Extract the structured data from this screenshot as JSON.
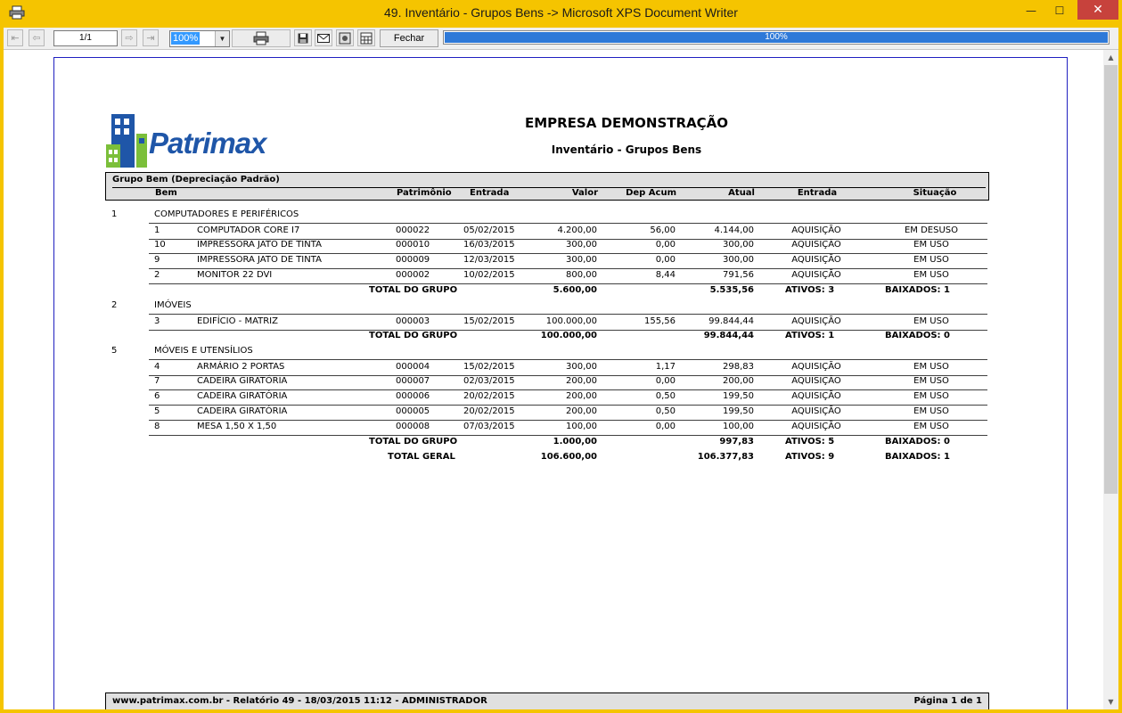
{
  "window": {
    "title": "49. Inventário - Grupos Bens -> Microsoft XPS Document Writer",
    "minimize_label": "—",
    "maximize_label": "☐",
    "close_label": "✕"
  },
  "toolbar": {
    "page_field": "1/1",
    "zoom": "100%",
    "close_button": "Fechar",
    "progress_text": "100%",
    "progress_percent": 100
  },
  "report": {
    "logo_text": "Patrimax",
    "company": "EMPRESA DEMONSTRAÇÃO",
    "title": "Inventário - Grupos Bens",
    "header": {
      "group_label": "Grupo Bem (Depreciação Padrão)",
      "bem": "Bem",
      "patrimonio": "Patrimônio",
      "entrada": "Entrada",
      "valor": "Valor",
      "dep_acum": "Dep Acum",
      "atual": "Atual",
      "entrada2": "Entrada",
      "situacao": "Situação"
    },
    "groups": [
      {
        "code": "1",
        "name": "COMPUTADORES E PERIFÉRICOS",
        "items": [
          {
            "id": "1",
            "name": "COMPUTADOR CORE I7",
            "patrimonio": "000022",
            "entrada": "05/02/2015",
            "valor": "4.200,00",
            "dep": "56,00",
            "atual": "4.144,00",
            "tipo": "AQUISIÇÃO",
            "situacao": "EM DESUSO"
          },
          {
            "id": "10",
            "name": "IMPRESSORA JATO DE TINTA",
            "patrimonio": "000010",
            "entrada": "16/03/2015",
            "valor": "300,00",
            "dep": "0,00",
            "atual": "300,00",
            "tipo": "AQUISIÇÃO",
            "situacao": "EM USO"
          },
          {
            "id": "9",
            "name": "IMPRESSORA JATO DE TINTA",
            "patrimonio": "000009",
            "entrada": "12/03/2015",
            "valor": "300,00",
            "dep": "0,00",
            "atual": "300,00",
            "tipo": "AQUISIÇÃO",
            "situacao": "EM USO"
          },
          {
            "id": "2",
            "name": "MONITOR 22 DVI",
            "patrimonio": "000002",
            "entrada": "10/02/2015",
            "valor": "800,00",
            "dep": "8,44",
            "atual": "791,56",
            "tipo": "AQUISIÇÃO",
            "situacao": "EM USO"
          }
        ],
        "total": {
          "label": "TOTAL DO GRUPO",
          "valor": "5.600,00",
          "atual": "5.535,56",
          "ativos": "ATIVOS: 3",
          "baixados": "BAIXADOS: 1"
        }
      },
      {
        "code": "2",
        "name": "IMÓVEIS",
        "items": [
          {
            "id": "3",
            "name": "EDIFÍCIO - MATRIZ",
            "patrimonio": "000003",
            "entrada": "15/02/2015",
            "valor": "100.000,00",
            "dep": "155,56",
            "atual": "99.844,44",
            "tipo": "AQUISIÇÃO",
            "situacao": "EM USO"
          }
        ],
        "total": {
          "label": "TOTAL DO GRUPO",
          "valor": "100.000,00",
          "atual": "99.844,44",
          "ativos": "ATIVOS: 1",
          "baixados": "BAIXADOS: 0"
        }
      },
      {
        "code": "5",
        "name": "MÓVEIS E UTENSÍLIOS",
        "items": [
          {
            "id": "4",
            "name": "ARMÁRIO 2 PORTAS",
            "patrimonio": "000004",
            "entrada": "15/02/2015",
            "valor": "300,00",
            "dep": "1,17",
            "atual": "298,83",
            "tipo": "AQUISIÇÃO",
            "situacao": "EM USO"
          },
          {
            "id": "7",
            "name": "CADEIRA GIRATÓRIA",
            "patrimonio": "000007",
            "entrada": "02/03/2015",
            "valor": "200,00",
            "dep": "0,00",
            "atual": "200,00",
            "tipo": "AQUISIÇÃO",
            "situacao": "EM USO"
          },
          {
            "id": "6",
            "name": "CADEIRA GIRATÓRIA",
            "patrimonio": "000006",
            "entrada": "20/02/2015",
            "valor": "200,00",
            "dep": "0,50",
            "atual": "199,50",
            "tipo": "AQUISIÇÃO",
            "situacao": "EM USO"
          },
          {
            "id": "5",
            "name": "CADEIRA GIRATÓRIA",
            "patrimonio": "000005",
            "entrada": "20/02/2015",
            "valor": "200,00",
            "dep": "0,50",
            "atual": "199,50",
            "tipo": "AQUISIÇÃO",
            "situacao": "EM USO"
          },
          {
            "id": "8",
            "name": "MESA 1,50 X 1,50",
            "patrimonio": "000008",
            "entrada": "07/03/2015",
            "valor": "100,00",
            "dep": "0,00",
            "atual": "100,00",
            "tipo": "AQUISIÇÃO",
            "situacao": "EM USO"
          }
        ],
        "total": {
          "label": "TOTAL DO GRUPO",
          "valor": "1.000,00",
          "atual": "997,83",
          "ativos": "ATIVOS: 5",
          "baixados": "BAIXADOS: 0"
        }
      }
    ],
    "grand_total": {
      "label": "TOTAL GERAL",
      "valor": "106.600,00",
      "atual": "106.377,83",
      "ativos": "ATIVOS: 9",
      "baixados": "BAIXADOS: 1"
    },
    "footer": {
      "left": "www.patrimax.com.br - Relatório 49 - 18/03/2015 11:12 - ADMINISTRADOR",
      "right": "Página 1 de 1"
    }
  }
}
